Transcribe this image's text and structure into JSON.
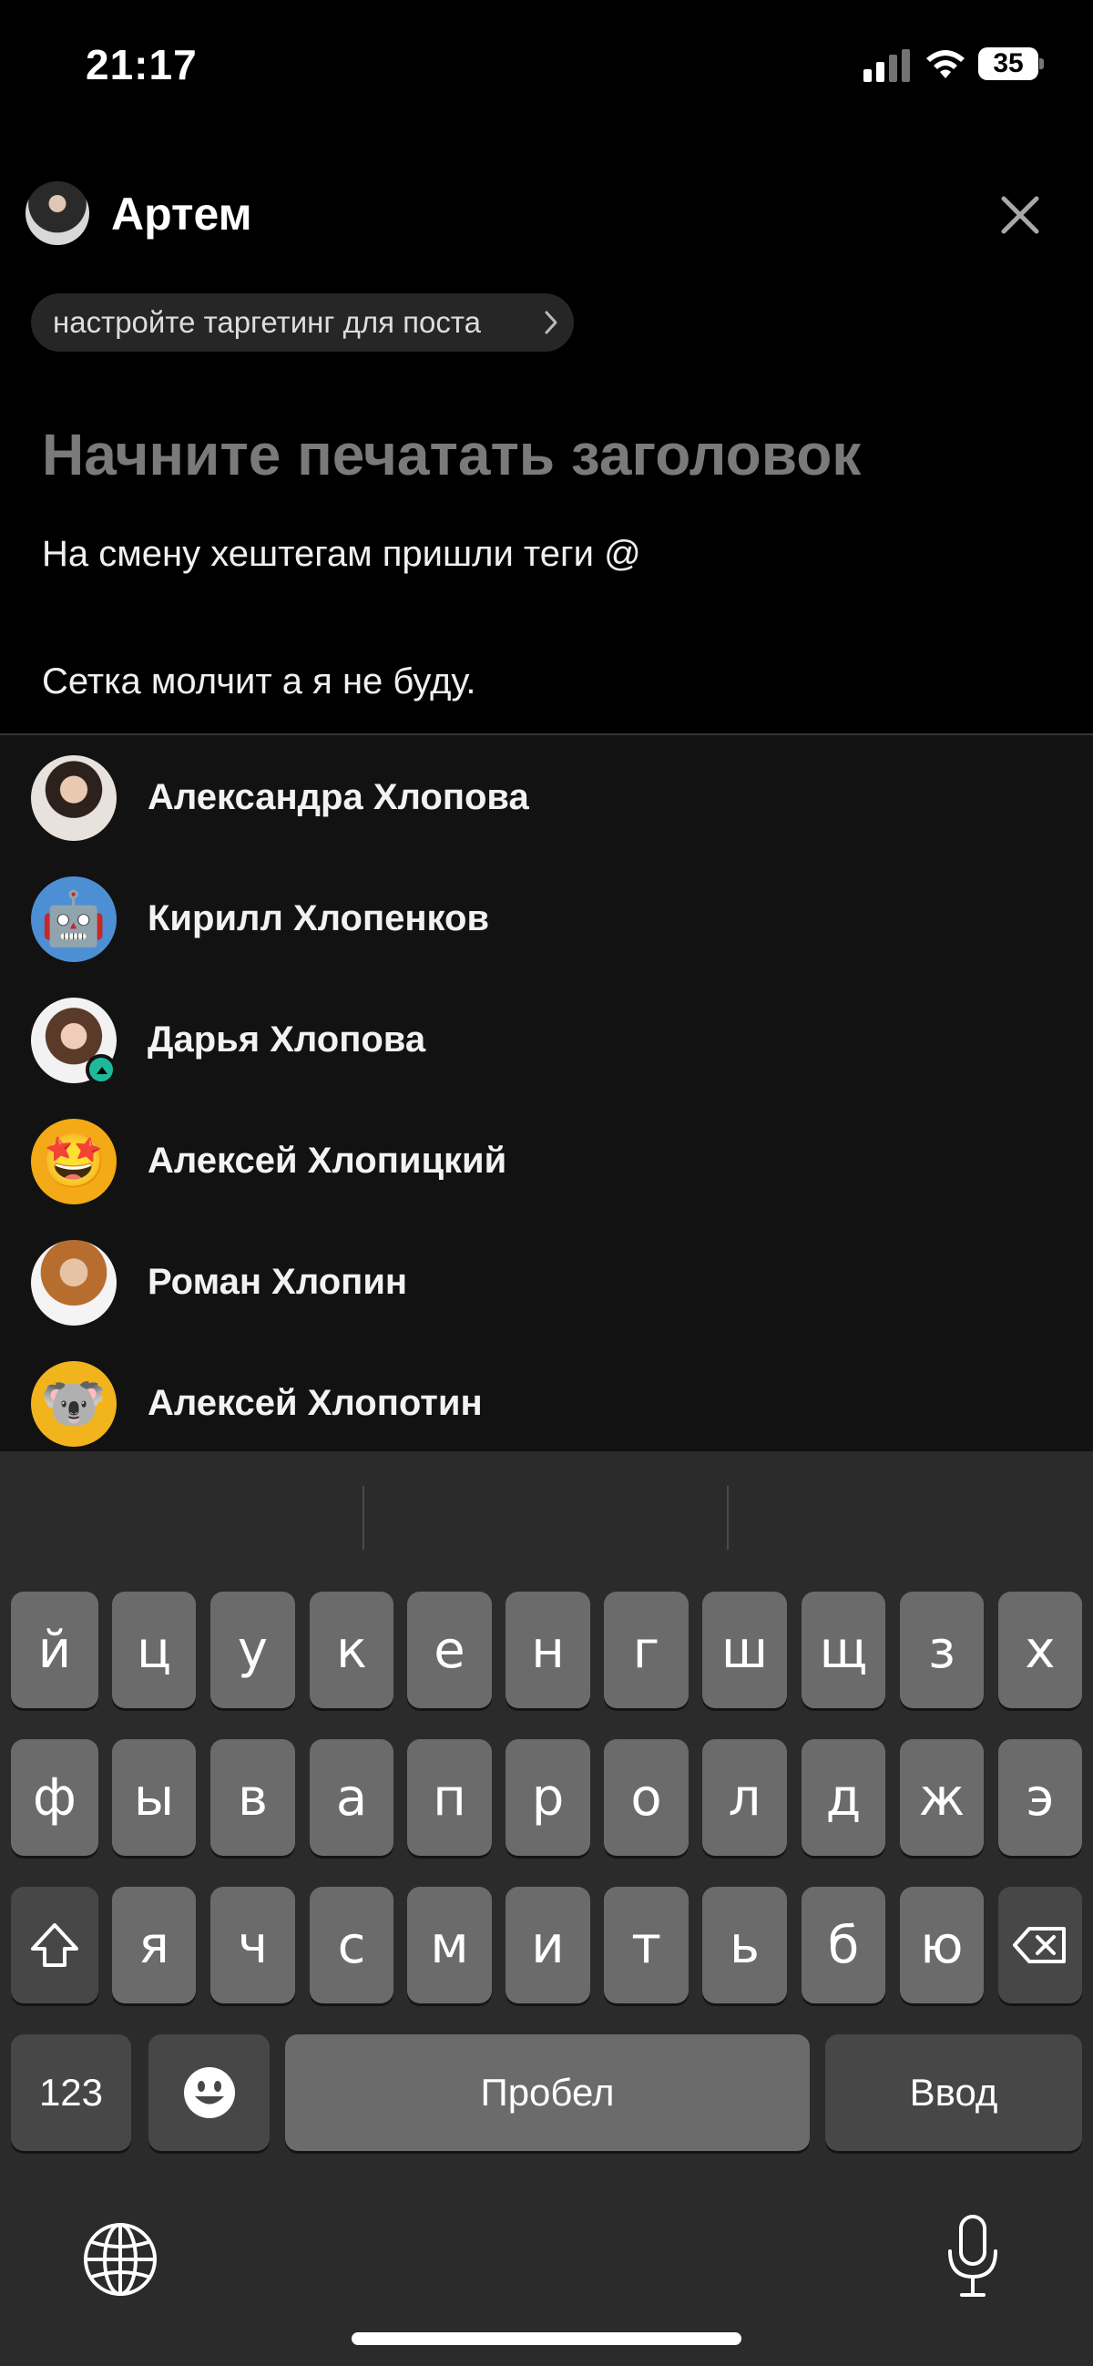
{
  "status_bar": {
    "time": "21:17",
    "battery": "35"
  },
  "header": {
    "author_name": "Артем"
  },
  "targeting": {
    "label": "настройте таргетинг для поста"
  },
  "editor": {
    "title_placeholder": "Начните печатать заголовок",
    "body_line_1": "На смену хештегам пришли теги @",
    "body_line_2": "Сетка молчит а я не буду."
  },
  "mentions": [
    {
      "name": "Александра Хлопова",
      "avatar": "photo"
    },
    {
      "name": "Кирилл Хлопенков",
      "avatar": "🤖"
    },
    {
      "name": "Дарья Хлопова",
      "avatar": "photo"
    },
    {
      "name": "Алексей Хлопицкий",
      "avatar": "🤩"
    },
    {
      "name": "Роман Хлопин",
      "avatar": "photo"
    },
    {
      "name": "Алексей Хлопотин",
      "avatar": "🐨"
    }
  ],
  "keyboard": {
    "row1": [
      "й",
      "ц",
      "у",
      "к",
      "е",
      "н",
      "г",
      "ш",
      "щ",
      "з",
      "х"
    ],
    "row2": [
      "ф",
      "ы",
      "в",
      "а",
      "п",
      "р",
      "о",
      "л",
      "д",
      "ж",
      "э"
    ],
    "row3": [
      "я",
      "ч",
      "с",
      "м",
      "и",
      "т",
      "ь",
      "б",
      "ю"
    ],
    "numbers_label": "123",
    "space_label": "Пробел",
    "return_label": "Ввод"
  },
  "colors": {
    "background": "#000000",
    "panel": "#121212",
    "keyboard": "#2b2b2b",
    "key": "#6b6b6b",
    "key_dark": "#474747",
    "placeholder": "#7a7a7a",
    "badge": "#1fb89b"
  }
}
